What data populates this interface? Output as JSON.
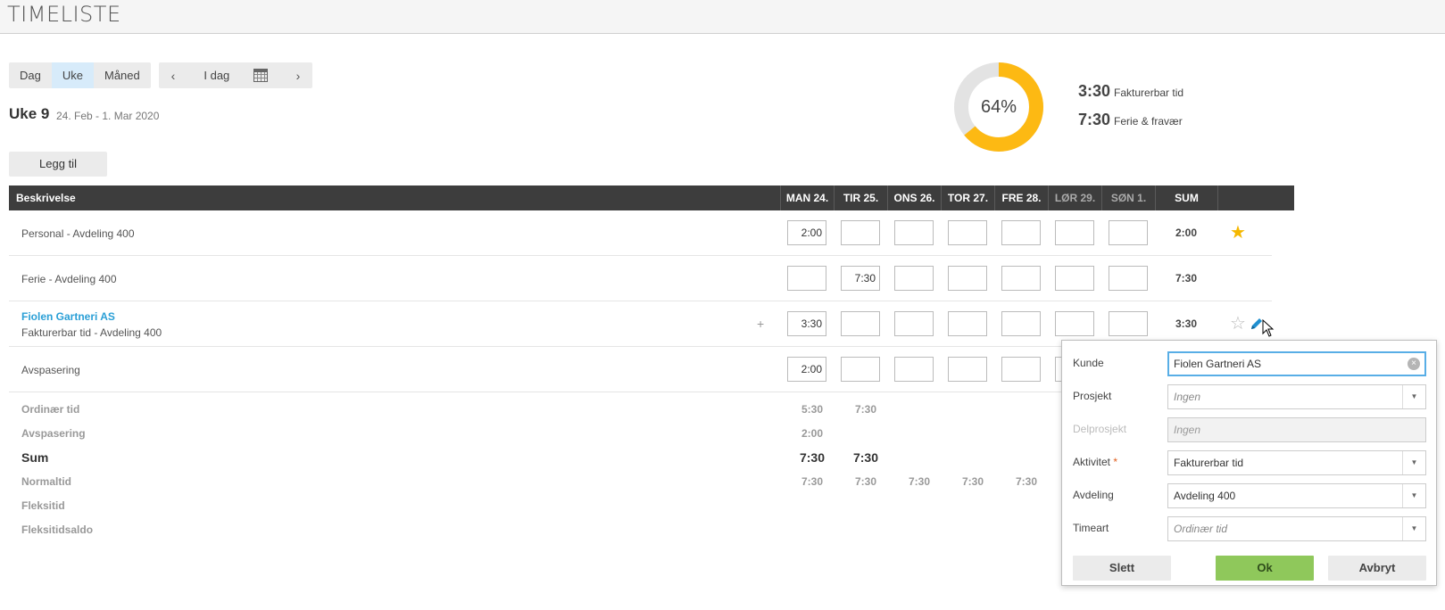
{
  "app": {
    "title": "TIMELISTE"
  },
  "view_tabs": [
    {
      "label": "Dag",
      "active": false
    },
    {
      "label": "Uke",
      "active": true
    },
    {
      "label": "Måned",
      "active": false
    }
  ],
  "nav": {
    "prev": "‹",
    "today": "I dag",
    "next": "›",
    "calendar_icon": "calendar-icon"
  },
  "week": {
    "title": "Uke 9",
    "range": "24. Feb - 1. Mar 2020"
  },
  "add_button": "Legg til",
  "donut": {
    "percent_label": "64%",
    "fraction": 0.64,
    "fill_color": "#fdb913",
    "track_color": "#e3e3e3"
  },
  "stats": [
    {
      "value": "3:30",
      "label": "Fakturerbar tid"
    },
    {
      "value": "7:30",
      "label": "Ferie & fravær"
    }
  ],
  "table": {
    "headers": [
      "Beskrivelse",
      "MAN 24.",
      "TIR 25.",
      "ONS 26.",
      "TOR 27.",
      "FRE 28.",
      "LØR 29.",
      "SØN 1.",
      "SUM"
    ],
    "rows": [
      {
        "customer": "",
        "desc": "Personal - Avdeling 400",
        "values": [
          "2:00",
          "",
          "",
          "",
          "",
          "",
          ""
        ],
        "sum": "2:00",
        "favorite": true
      },
      {
        "customer": "",
        "desc": "Ferie - Avdeling 400",
        "values": [
          "",
          "7:30",
          "",
          "",
          "",
          "",
          ""
        ],
        "sum": "7:30",
        "favorite": false
      },
      {
        "customer": "Fiolen Gartneri AS",
        "desc": "Fakturerbar tid - Avdeling 400",
        "values": [
          "3:30",
          "",
          "",
          "",
          "",
          "",
          ""
        ],
        "sum": "3:30",
        "favorite": false
      },
      {
        "customer": "",
        "desc": "Avspasering",
        "values": [
          "2:00",
          "",
          "",
          "",
          "",
          "",
          ""
        ],
        "sum": "",
        "favorite": false
      }
    ]
  },
  "summary": [
    {
      "label": "Ordinær tid",
      "values": [
        "5:30",
        "7:30",
        "",
        "",
        ""
      ]
    },
    {
      "label": "Avspasering",
      "values": [
        "2:00",
        "",
        "",
        "",
        ""
      ]
    },
    {
      "label": "Sum",
      "values": [
        "7:30",
        "7:30",
        "",
        "",
        ""
      ]
    },
    {
      "label": "Normaltid",
      "values": [
        "7:30",
        "7:30",
        "7:30",
        "7:30",
        "7:30"
      ]
    },
    {
      "label": "Fleksitid",
      "values": [
        "",
        "",
        "",
        "",
        ""
      ]
    },
    {
      "label": "Fleksitidsaldo",
      "values": [
        "",
        "",
        "",
        "",
        ""
      ]
    }
  ],
  "popup": {
    "kunde_label": "Kunde",
    "kunde_value": "Fiolen Gartneri AS",
    "prosjekt_label": "Prosjekt",
    "prosjekt_value": "Ingen",
    "delprosjekt_label": "Delprosjekt",
    "delprosjekt_value": "Ingen",
    "aktivitet_label": "Aktivitet",
    "aktivitet_required": "*",
    "aktivitet_value": "Fakturerbar tid",
    "avdeling_label": "Avdeling",
    "avdeling_value": "Avdeling 400",
    "timeart_label": "Timeart",
    "timeart_value": "Ordinær tid",
    "delete_label": "Slett",
    "ok_label": "Ok",
    "cancel_label": "Avbryt"
  }
}
